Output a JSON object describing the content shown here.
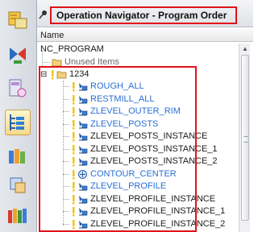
{
  "navigator": {
    "title": "Operation Navigator - Program Order",
    "column_header": "Name"
  },
  "tree": {
    "root": "NC_PROGRAM",
    "unused": "Unused Items",
    "program": "1234",
    "operations": [
      {
        "label": "ROUGH_ALL",
        "color": "blue"
      },
      {
        "label": "RESTMILL_ALL",
        "color": "blue"
      },
      {
        "label": "ZLEVEL_OUTER_RIM",
        "color": "blue"
      },
      {
        "label": "ZLEVEL_POSTS",
        "color": "blue"
      },
      {
        "label": "ZLEVEL_POSTS_INSTANCE",
        "color": "black"
      },
      {
        "label": "ZLEVEL_POSTS_INSTANCE_1",
        "color": "black"
      },
      {
        "label": "ZLEVEL_POSTS_INSTANCE_2",
        "color": "black"
      },
      {
        "label": "CONTOUR_CENTER",
        "color": "blue"
      },
      {
        "label": "ZLEVEL_PROFILE",
        "color": "blue"
      },
      {
        "label": "ZLEVEL_PROFILE_INSTANCE",
        "color": "black"
      },
      {
        "label": "ZLEVEL_PROFILE_INSTANCE_1",
        "color": "black"
      },
      {
        "label": "ZLEVEL_PROFILE_INSTANCE_2",
        "color": "black"
      }
    ]
  },
  "colors": {
    "highlight_box": "#e0121a",
    "blue_text": "#2a6fd6",
    "black_text": "#1a1a1a"
  },
  "resource_bar_icons": [
    "part-navigator-icon",
    "assembly-navigator-icon",
    "machine-tool-icon",
    "operation-navigator-icon",
    "library-icon",
    "roles-icon",
    "history-icon"
  ]
}
